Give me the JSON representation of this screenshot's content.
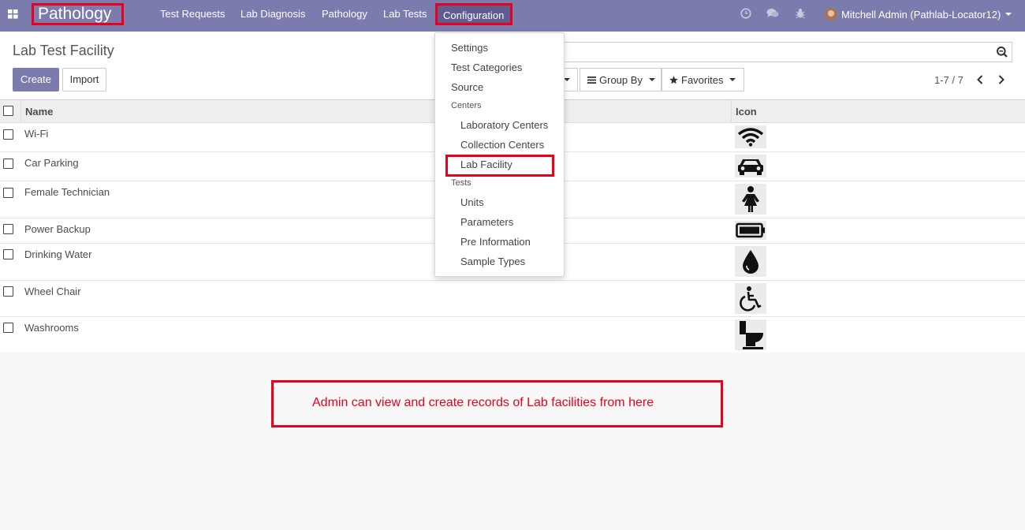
{
  "colors": {
    "navbar": "#7c7bad",
    "primary": "#7c7bad",
    "annotation": "#e8001c"
  },
  "navbar": {
    "app_name": "Pathology",
    "menus": [
      "Test Requests",
      "Lab Diagnosis",
      "Pathology",
      "Lab Tests",
      "Configuration"
    ],
    "user": "Mitchell Admin (Pathlab-Locator12)",
    "icons": [
      "apps-grid-icon",
      "clock-icon",
      "chat-icon",
      "bug-icon"
    ]
  },
  "control_panel": {
    "title": "Lab Test Facility",
    "create_label": "Create",
    "import_label": "Import",
    "group_by_label": "Group By",
    "favorites_label": "Favorites",
    "pager": "1-7 / 7"
  },
  "table": {
    "columns": [
      "Name",
      "Icon"
    ],
    "rows": [
      {
        "name": "Wi-Fi",
        "icon": "wifi-icon"
      },
      {
        "name": "Car Parking",
        "icon": "car-icon"
      },
      {
        "name": "Female Technician",
        "icon": "female-icon"
      },
      {
        "name": "Power Backup",
        "icon": "battery-icon"
      },
      {
        "name": "Drinking Water",
        "icon": "water-drop-icon"
      },
      {
        "name": "Wheel Chair",
        "icon": "wheelchair-icon"
      },
      {
        "name": "Washrooms",
        "icon": "toilet-icon"
      }
    ]
  },
  "dropdown": {
    "settings": "Settings",
    "test_categories": "Test Categories",
    "source": "Source",
    "centers_header": "Centers",
    "laboratory_centers": "Laboratory Centers",
    "collection_centers": "Collection Centers",
    "lab_facility": "Lab Facility",
    "tests_header": "Tests",
    "units": "Units",
    "parameters": "Parameters",
    "pre_information": "Pre Information",
    "sample_types": "Sample Types"
  },
  "annotation": "Admin can view and create records of Lab facilities from here"
}
